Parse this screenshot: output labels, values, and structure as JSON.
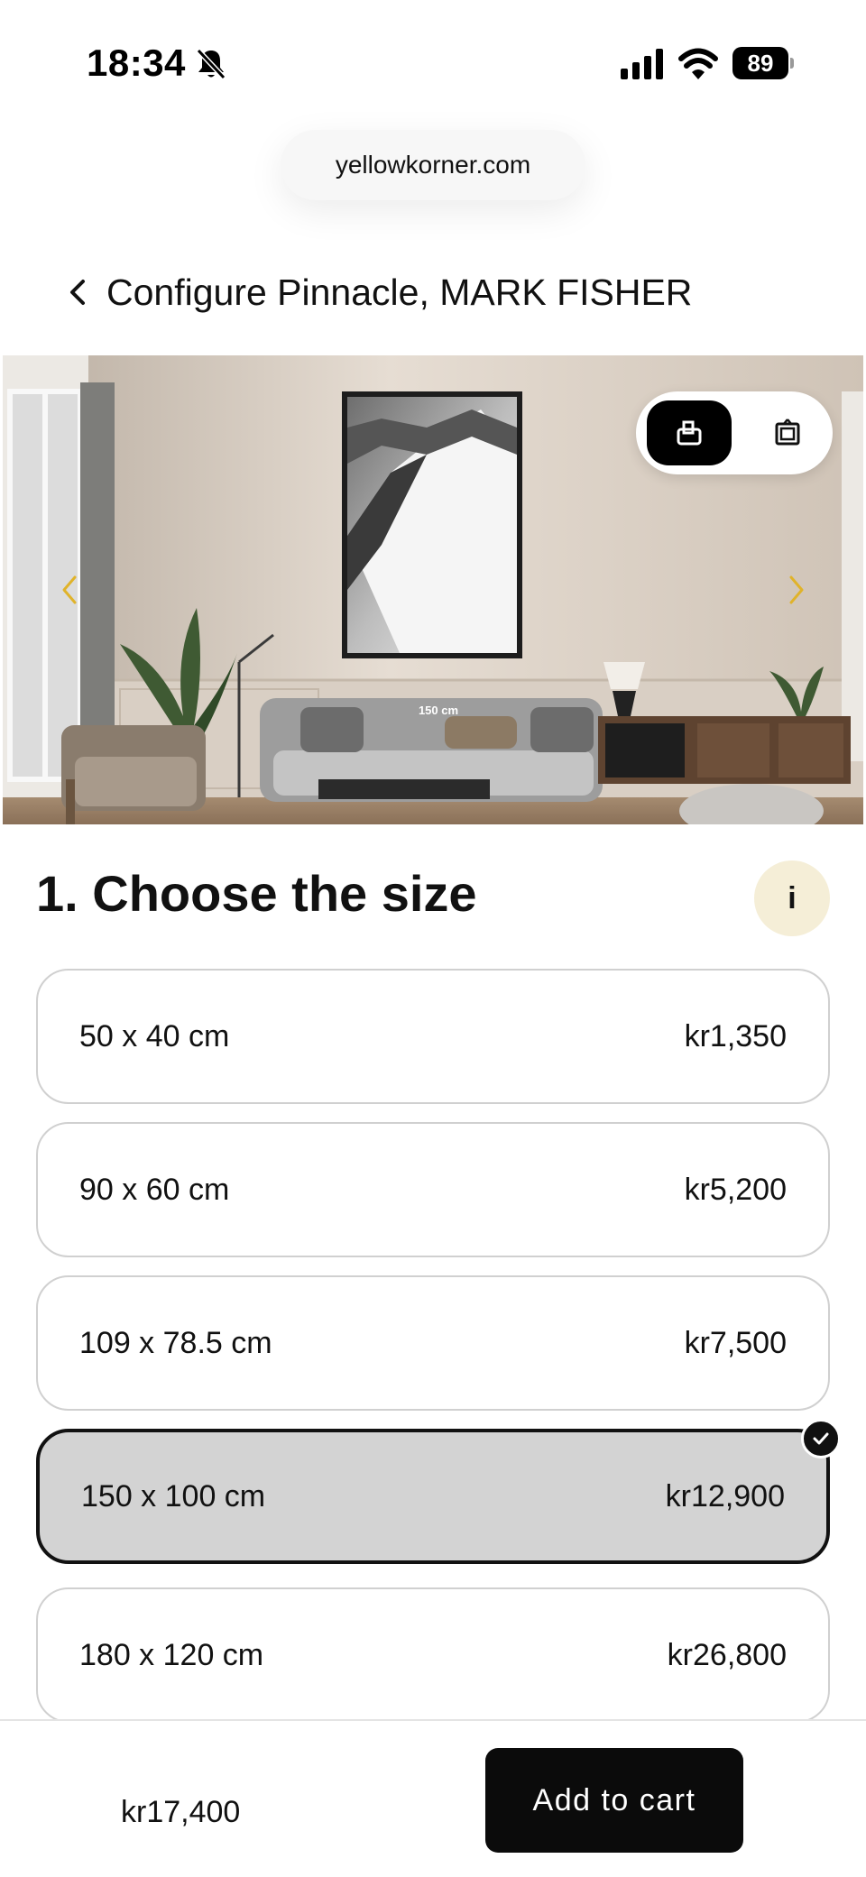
{
  "status_bar": {
    "time": "18:34",
    "battery": "89",
    "icons": [
      "bell-slash-icon",
      "signal-icon",
      "wifi-icon",
      "battery-icon"
    ]
  },
  "browser": {
    "url": "yellowkorner.com"
  },
  "header": {
    "title": "Configure Pinnacle, MARK FISHER",
    "back_icon": "chevron-left-icon"
  },
  "hero": {
    "size_label": "150 cm",
    "view_toggle": {
      "active": "room-view-icon",
      "inactive": "frame-view-icon"
    },
    "arrow_color": "#e0b32a"
  },
  "section": {
    "title": "1. Choose the size",
    "info_label": "i",
    "info_bg": "#f5eed7"
  },
  "sizes": [
    {
      "dimensions": "50 x 40 cm",
      "price": "kr1,350",
      "selected": false
    },
    {
      "dimensions": "90 x 60 cm",
      "price": "kr5,200",
      "selected": false
    },
    {
      "dimensions": "109 x 78.5 cm",
      "price": "kr7,500",
      "selected": false
    },
    {
      "dimensions": "150 x 100 cm",
      "price": "kr12,900",
      "selected": true
    },
    {
      "dimensions": "180 x 120 cm",
      "price": "kr26,800",
      "selected": false
    }
  ],
  "bottom_bar": {
    "total_price": "kr17,400",
    "add_to_cart_label": "Add to cart"
  }
}
